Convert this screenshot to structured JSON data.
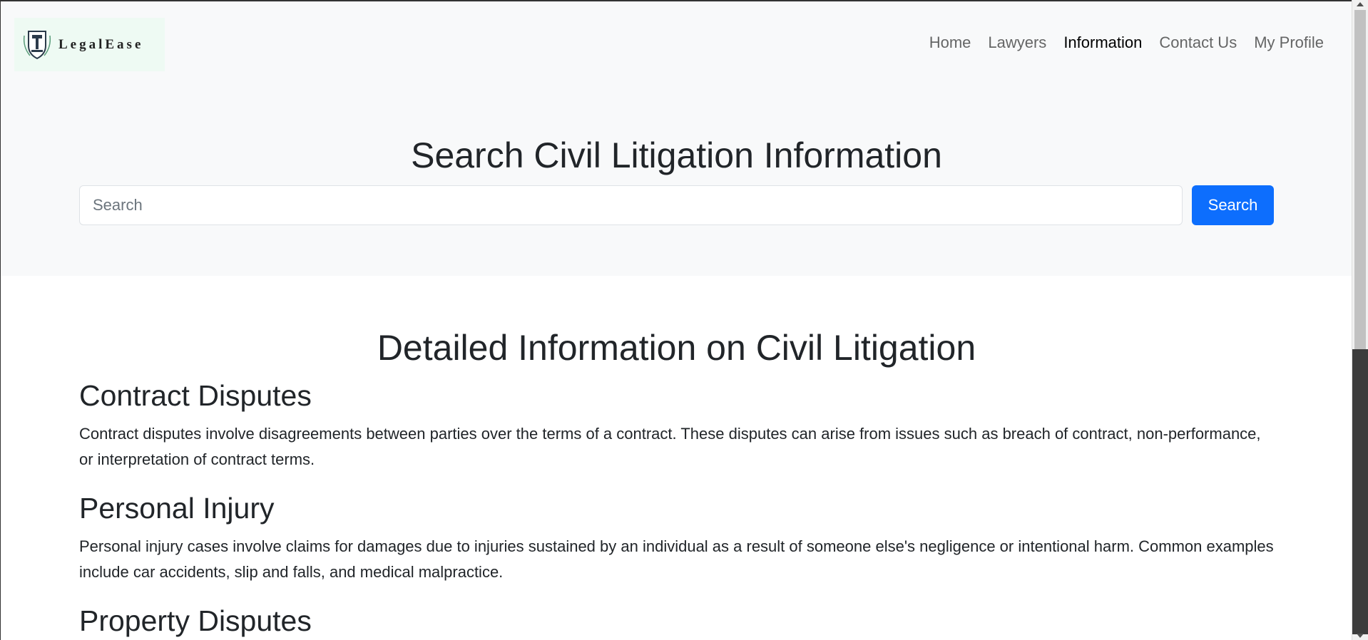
{
  "brand": {
    "name": "LegalEase"
  },
  "nav": {
    "items": [
      {
        "label": "Home",
        "active": false
      },
      {
        "label": "Lawyers",
        "active": false
      },
      {
        "label": "Information",
        "active": true
      },
      {
        "label": "Contact Us",
        "active": false
      },
      {
        "label": "My Profile",
        "active": false
      }
    ]
  },
  "search": {
    "title": "Search Civil Litigation Information",
    "placeholder": "Search",
    "value": "",
    "button_label": "Search",
    "button_color": "#0d6efd"
  },
  "details": {
    "title": "Detailed Information on Civil Litigation",
    "sections": [
      {
        "heading": "Contract Disputes",
        "body": "Contract disputes involve disagreements between parties over the terms of a contract. These disputes can arise from issues such as breach of contract, non-performance, or interpretation of contract terms."
      },
      {
        "heading": "Personal Injury",
        "body": "Personal injury cases involve claims for damages due to injuries sustained by an individual as a result of someone else's negligence or intentional harm. Common examples include car accidents, slip and falls, and medical malpractice."
      },
      {
        "heading": "Property Disputes",
        "body": ""
      }
    ]
  }
}
